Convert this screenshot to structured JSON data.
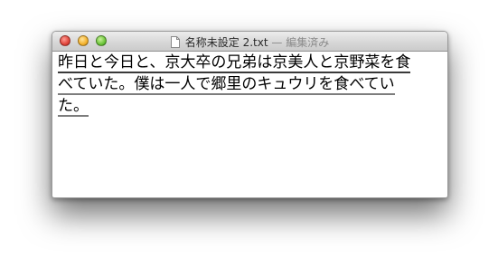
{
  "window": {
    "title_file": "名称未設定 2.txt",
    "title_status": "— 編集済み"
  },
  "editor": {
    "lines": [
      "昨日と今日と、京大卒の兄弟は京美人と京野菜を食",
      "べていた。僕は一人で郷里のキュウリを食べてい",
      "た。"
    ]
  }
}
